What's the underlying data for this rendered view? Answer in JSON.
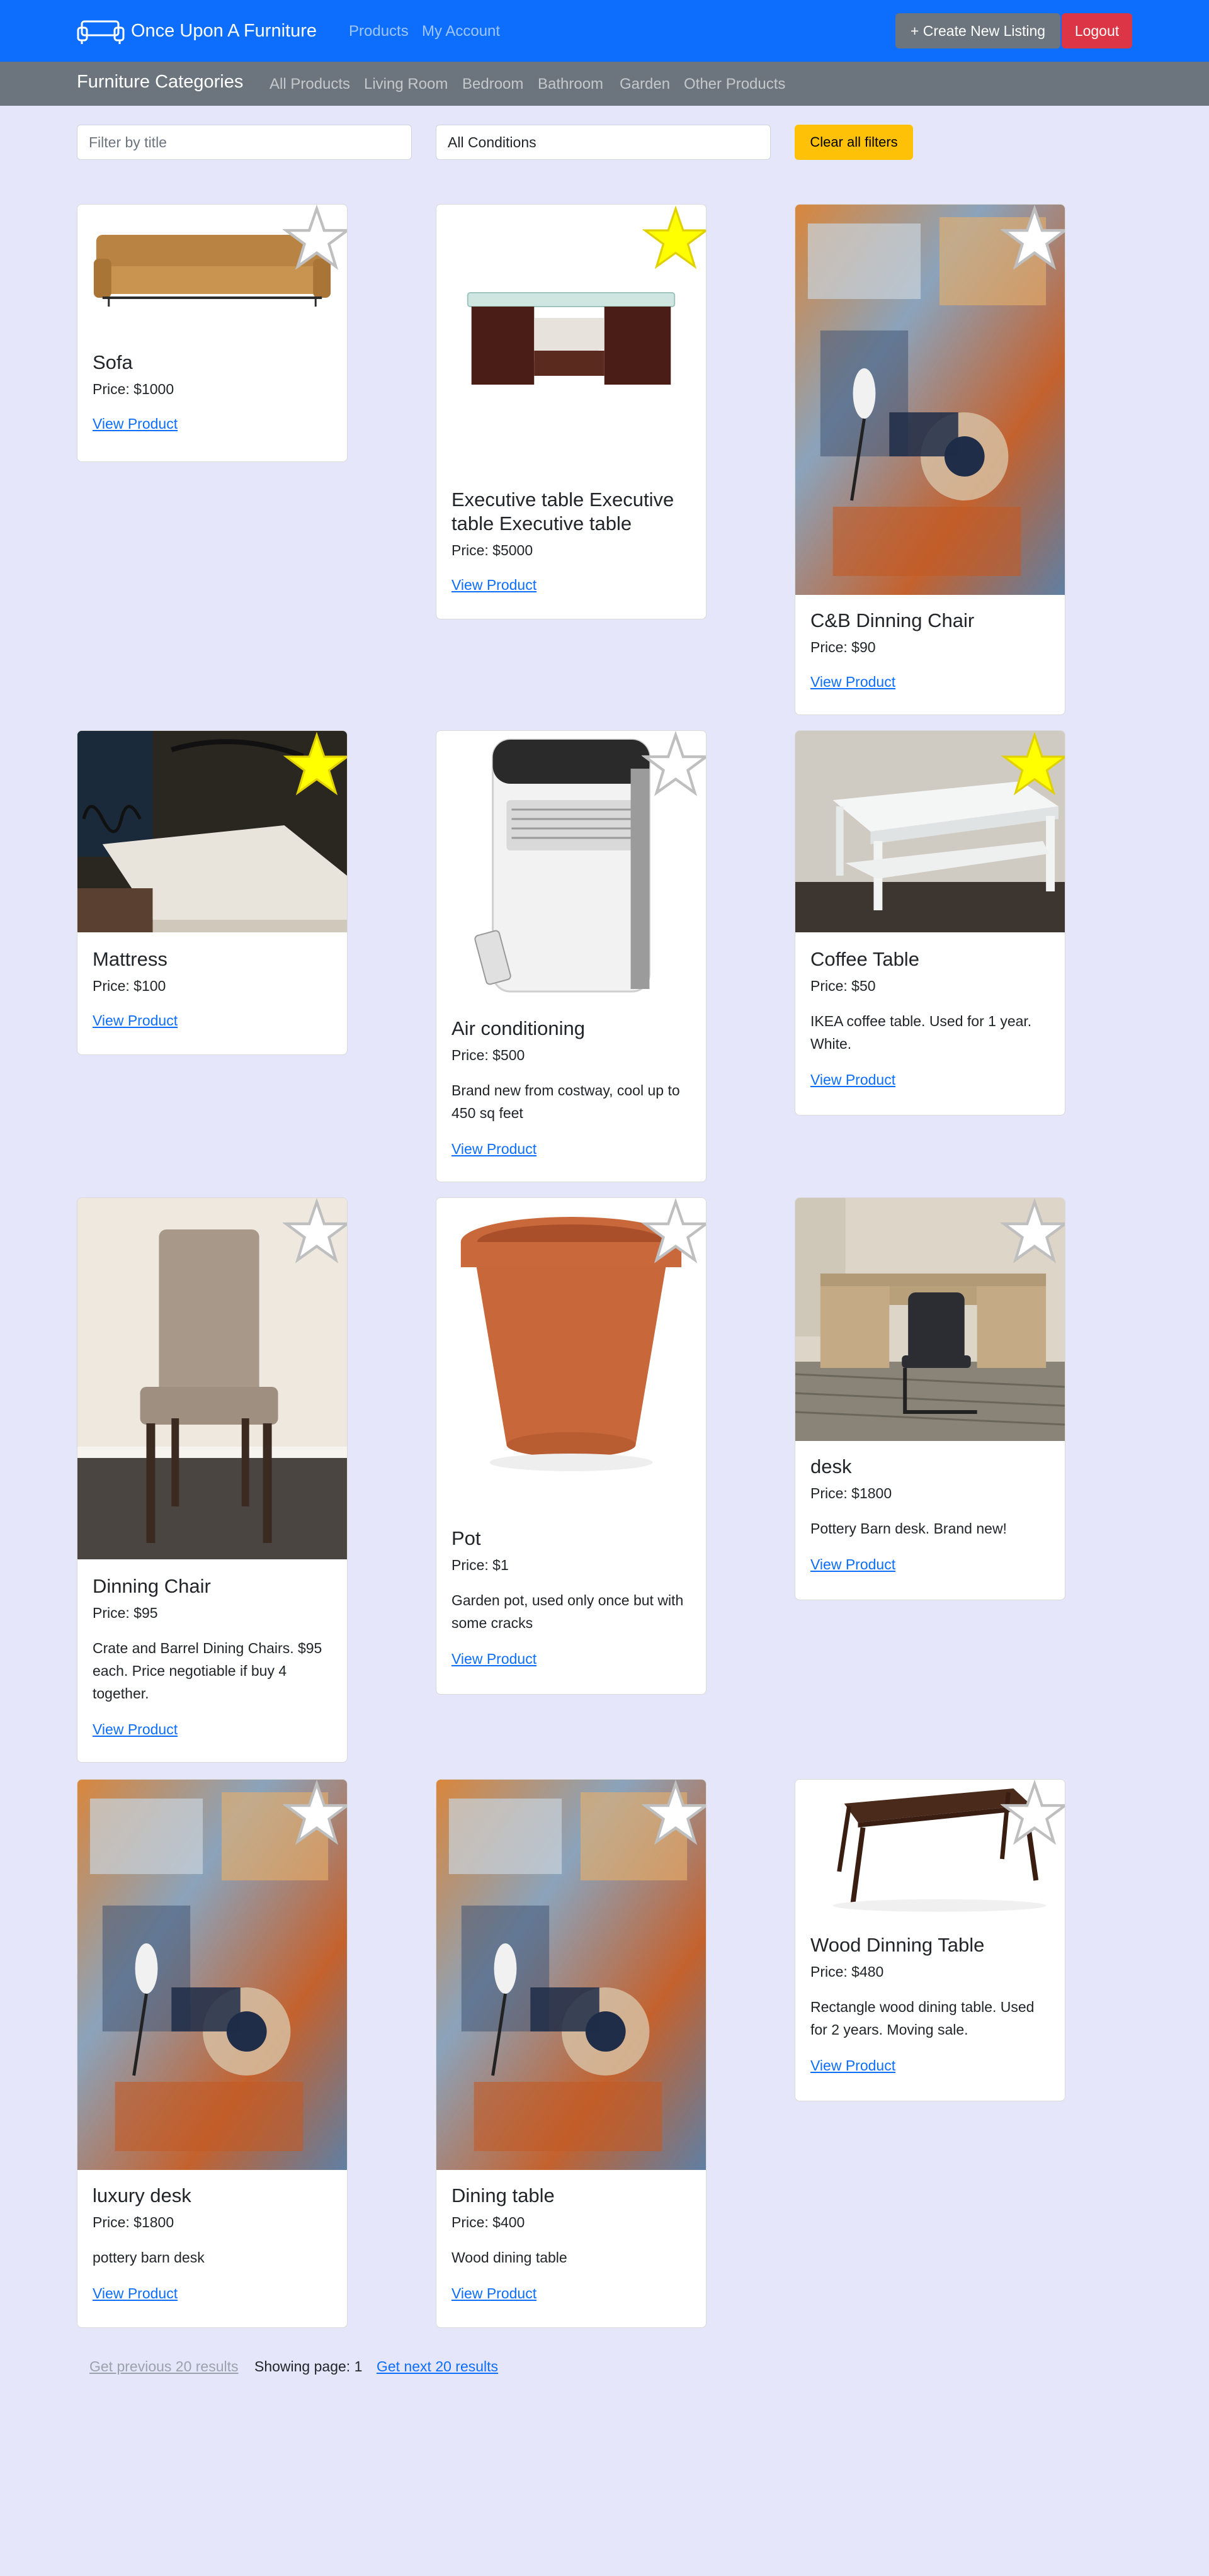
{
  "navbar": {
    "brand": "Once Upon A Furniture",
    "links": [
      "Products",
      "My Account"
    ],
    "create_button": "+ Create New Listing",
    "logout_button": "Logout"
  },
  "categories": {
    "title": "Furniture Categories",
    "items": [
      "All Products",
      "Living Room",
      "Bedroom",
      "Bathroom",
      "Garden",
      "Other Products"
    ]
  },
  "filters": {
    "title_placeholder": "Filter by title",
    "condition_value": "All Conditions",
    "clear_button": "Clear all filters"
  },
  "products": [
    {
      "title": "Sofa",
      "price": "Price: $1000",
      "desc": "",
      "link": "View Product",
      "starred": false
    },
    {
      "title": "Executive table Executive table Executive table",
      "price": "Price: $5000",
      "desc": "",
      "link": "View Product",
      "starred": true
    },
    {
      "title": "C&B Dinning Chair",
      "price": "Price: $90",
      "desc": "",
      "link": "View Product",
      "starred": false
    },
    {
      "title": "Mattress",
      "price": "Price: $100",
      "desc": "",
      "link": "View Product",
      "starred": true
    },
    {
      "title": "Air conditioning",
      "price": "Price: $500",
      "desc": "Brand new from costway, cool up to 450 sq feet",
      "link": "View Product",
      "starred": false
    },
    {
      "title": "Coffee Table",
      "price": "Price: $50",
      "desc": "IKEA coffee table. Used for 1 year. White.",
      "link": "View Product",
      "starred": true
    },
    {
      "title": "Dinning Chair",
      "price": "Price: $95",
      "desc": "Crate and Barrel Dining Chairs. $95 each. Price negotiable if buy 4 together.",
      "link": "View Product",
      "starred": false
    },
    {
      "title": "Pot",
      "price": "Price: $1",
      "desc": "Garden pot, used only once but with some cracks",
      "link": "View Product",
      "starred": false
    },
    {
      "title": "desk",
      "price": "Price: $1800",
      "desc": "Pottery Barn desk. Brand new!",
      "link": "View Product",
      "starred": false
    },
    {
      "title": "luxury desk",
      "price": "Price: $1800",
      "desc": "pottery barn desk",
      "link": "View Product",
      "starred": false
    },
    {
      "title": "Dining table",
      "price": "Price: $400",
      "desc": "Wood dining table",
      "link": "View Product",
      "starred": false
    },
    {
      "title": "Wood Dinning Table",
      "price": "Price: $480",
      "desc": "Rectangle wood dining table. Used for 2 years. Moving sale.",
      "link": "View Product",
      "starred": false
    }
  ],
  "pagination": {
    "prev": "Get previous 20 results",
    "page": "Showing page: 1",
    "next": "Get next 20 results"
  },
  "colors": {
    "primary": "#0d6efd",
    "secondary": "#6c757d",
    "danger": "#dc3545",
    "warning": "#ffc107",
    "background": "#e6e6fa",
    "star_active": "#ffff00"
  }
}
